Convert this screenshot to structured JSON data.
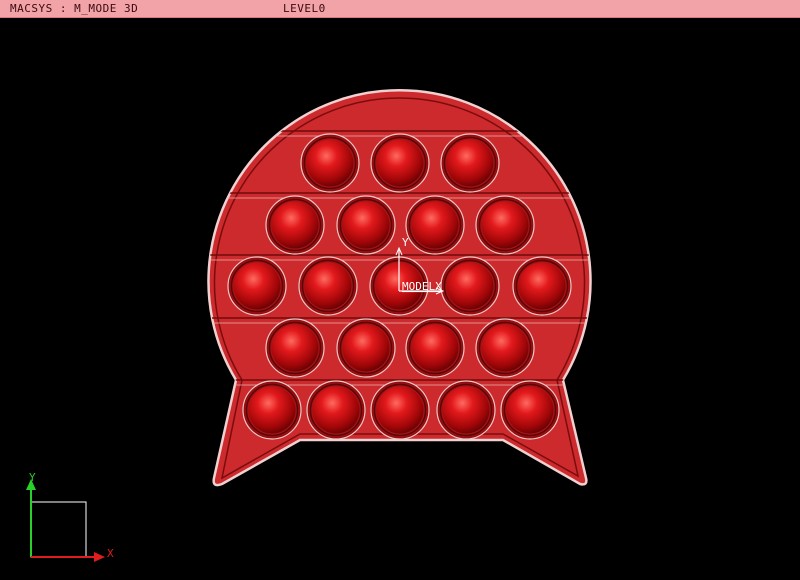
{
  "titlebar": {
    "system_label": "MACSYS : M_MODE 3D",
    "level_label": "LEVEL0"
  },
  "model_axis": {
    "y_label": "Y",
    "name_label": "MODELX"
  },
  "view_triad": {
    "x_label": "X",
    "y_label": "Y"
  },
  "colors": {
    "background": "#000000",
    "titlebar": "#f2a3a8",
    "part_body": "#cc2a2c",
    "part_outline": "#f0d0d0",
    "bubble": "#c81214",
    "axis_white": "#ffffff",
    "triad_x": "#e01c1c",
    "triad_y": "#2ad02a"
  },
  "bubbles_per_row": [
    3,
    4,
    5,
    4,
    5
  ]
}
